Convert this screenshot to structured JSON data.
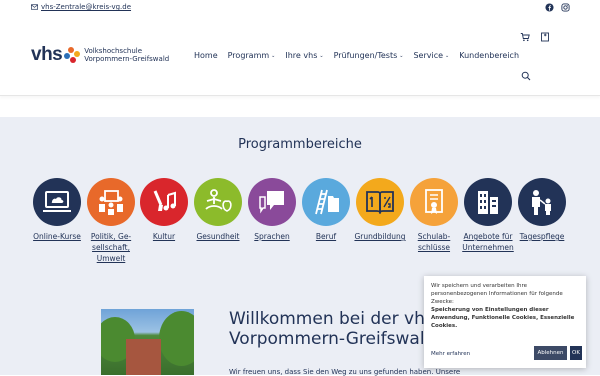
{
  "topbar": {
    "email": "vhs-Zentrale@kreis-vg.de",
    "icons": [
      "facebook-icon",
      "instagram-icon"
    ]
  },
  "header": {
    "logo_text": "vhs",
    "logo_sub_line1": "Volkshochschule",
    "logo_sub_line2": "Vorpommern-Greifswald",
    "nav": [
      {
        "label": "Home",
        "dropdown": false
      },
      {
        "label": "Programm",
        "dropdown": true
      },
      {
        "label": "Ihre vhs",
        "dropdown": true
      },
      {
        "label": "Prüfungen/Tests",
        "dropdown": true
      },
      {
        "label": "Service",
        "dropdown": true
      },
      {
        "label": "Kundenbereich",
        "dropdown": false
      }
    ],
    "caret": "⌄",
    "icons": [
      "cart-icon",
      "bookmark-icon",
      "search-icon"
    ]
  },
  "section": {
    "title": "Programmbereiche",
    "categories": [
      {
        "label": "Online-Kurse",
        "color": "#223357"
      },
      {
        "label": "Politik, Ge-\nsellschaft,\nUmwelt",
        "color": "#e8692a"
      },
      {
        "label": "Kultur",
        "color": "#d9262c"
      },
      {
        "label": "Gesundheit",
        "color": "#8cbb2b"
      },
      {
        "label": "Sprachen",
        "color": "#8a4a9a"
      },
      {
        "label": "Beruf",
        "color": "#5aa9dd"
      },
      {
        "label": "Grundbildung",
        "color": "#f3a91c"
      },
      {
        "label": "Schulab-\nschlüsse",
        "color": "#f5a23a"
      },
      {
        "label": "Angebote für\nUnternehmen",
        "color": "#223357"
      },
      {
        "label": "Tagespflege",
        "color": "#223357"
      }
    ]
  },
  "welcome": {
    "title_line1": "Willkommen bei der vhs",
    "title_line2": "Vorpommern-Greifswald",
    "text": "Wir freuen uns, dass Sie den Weg zu uns gefunden haben. Unsere"
  },
  "cookie": {
    "text": "Wir speichern und verarbeiten Ihre personenbezogenen Informationen für folgende Zwecke:",
    "purposes": "Speicherung von Einstellungen dieser Anwendung, Funktionelle Cookies, Essenzielle Cookies.",
    "more_link": "Mehr erfahren",
    "decline_label": "Ablehnen",
    "ok_label": "OK"
  }
}
